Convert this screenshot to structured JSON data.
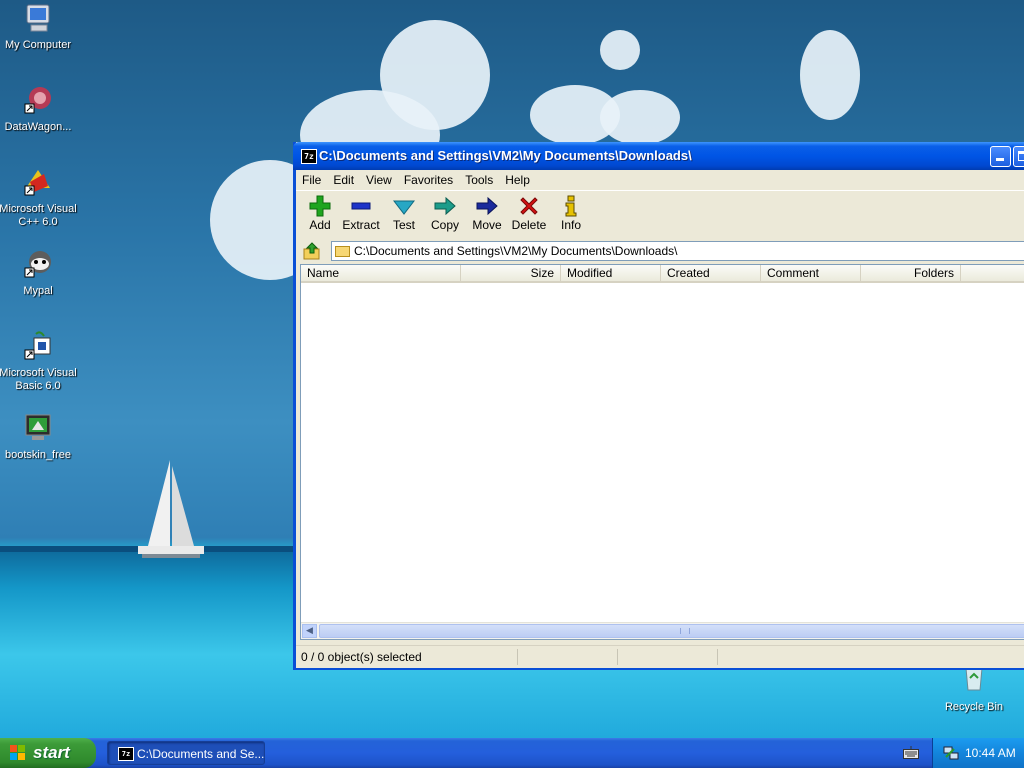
{
  "desktop": {
    "icons": [
      {
        "label": "My Computer"
      },
      {
        "label": "DataWagon..."
      },
      {
        "label": "Microsoft Visual\nC++ 6.0"
      },
      {
        "label": "Mypal"
      },
      {
        "label": "Microsoft Visual\nBasic 6.0"
      },
      {
        "label": "bootskin_free"
      },
      {
        "label": "Recycle Bin"
      }
    ]
  },
  "window": {
    "title": "C:\\Documents and Settings\\VM2\\My Documents\\Downloads\\",
    "title_icon": "7z",
    "menu": [
      "File",
      "Edit",
      "View",
      "Favorites",
      "Tools",
      "Help"
    ],
    "toolbar": [
      {
        "label": "Add",
        "icon": "plus-icon",
        "color": "#1fa51f"
      },
      {
        "label": "Extract",
        "icon": "minus-icon",
        "color": "#1d33c8"
      },
      {
        "label": "Test",
        "icon": "check-icon",
        "color": "#27a7c4"
      },
      {
        "label": "Copy",
        "icon": "arrow-right-icon",
        "color": "#1c9c8a"
      },
      {
        "label": "Move",
        "icon": "arrow-right-icon",
        "color": "#1a2a9c"
      },
      {
        "label": "Delete",
        "icon": "x-icon",
        "color": "#d51212"
      },
      {
        "label": "Info",
        "icon": "info-icon",
        "color": "#d8b400"
      }
    ],
    "address": "C:\\Documents and Settings\\VM2\\My Documents\\Downloads\\",
    "columns": [
      "Name",
      "Size",
      "Modified",
      "Created",
      "Comment",
      "Folders"
    ],
    "status": "0 / 0 object(s) selected"
  },
  "taskbar": {
    "start_label": "start",
    "task_label": "C:\\Documents and Se...",
    "task_icon": "7z",
    "clock": "10:44 AM"
  }
}
